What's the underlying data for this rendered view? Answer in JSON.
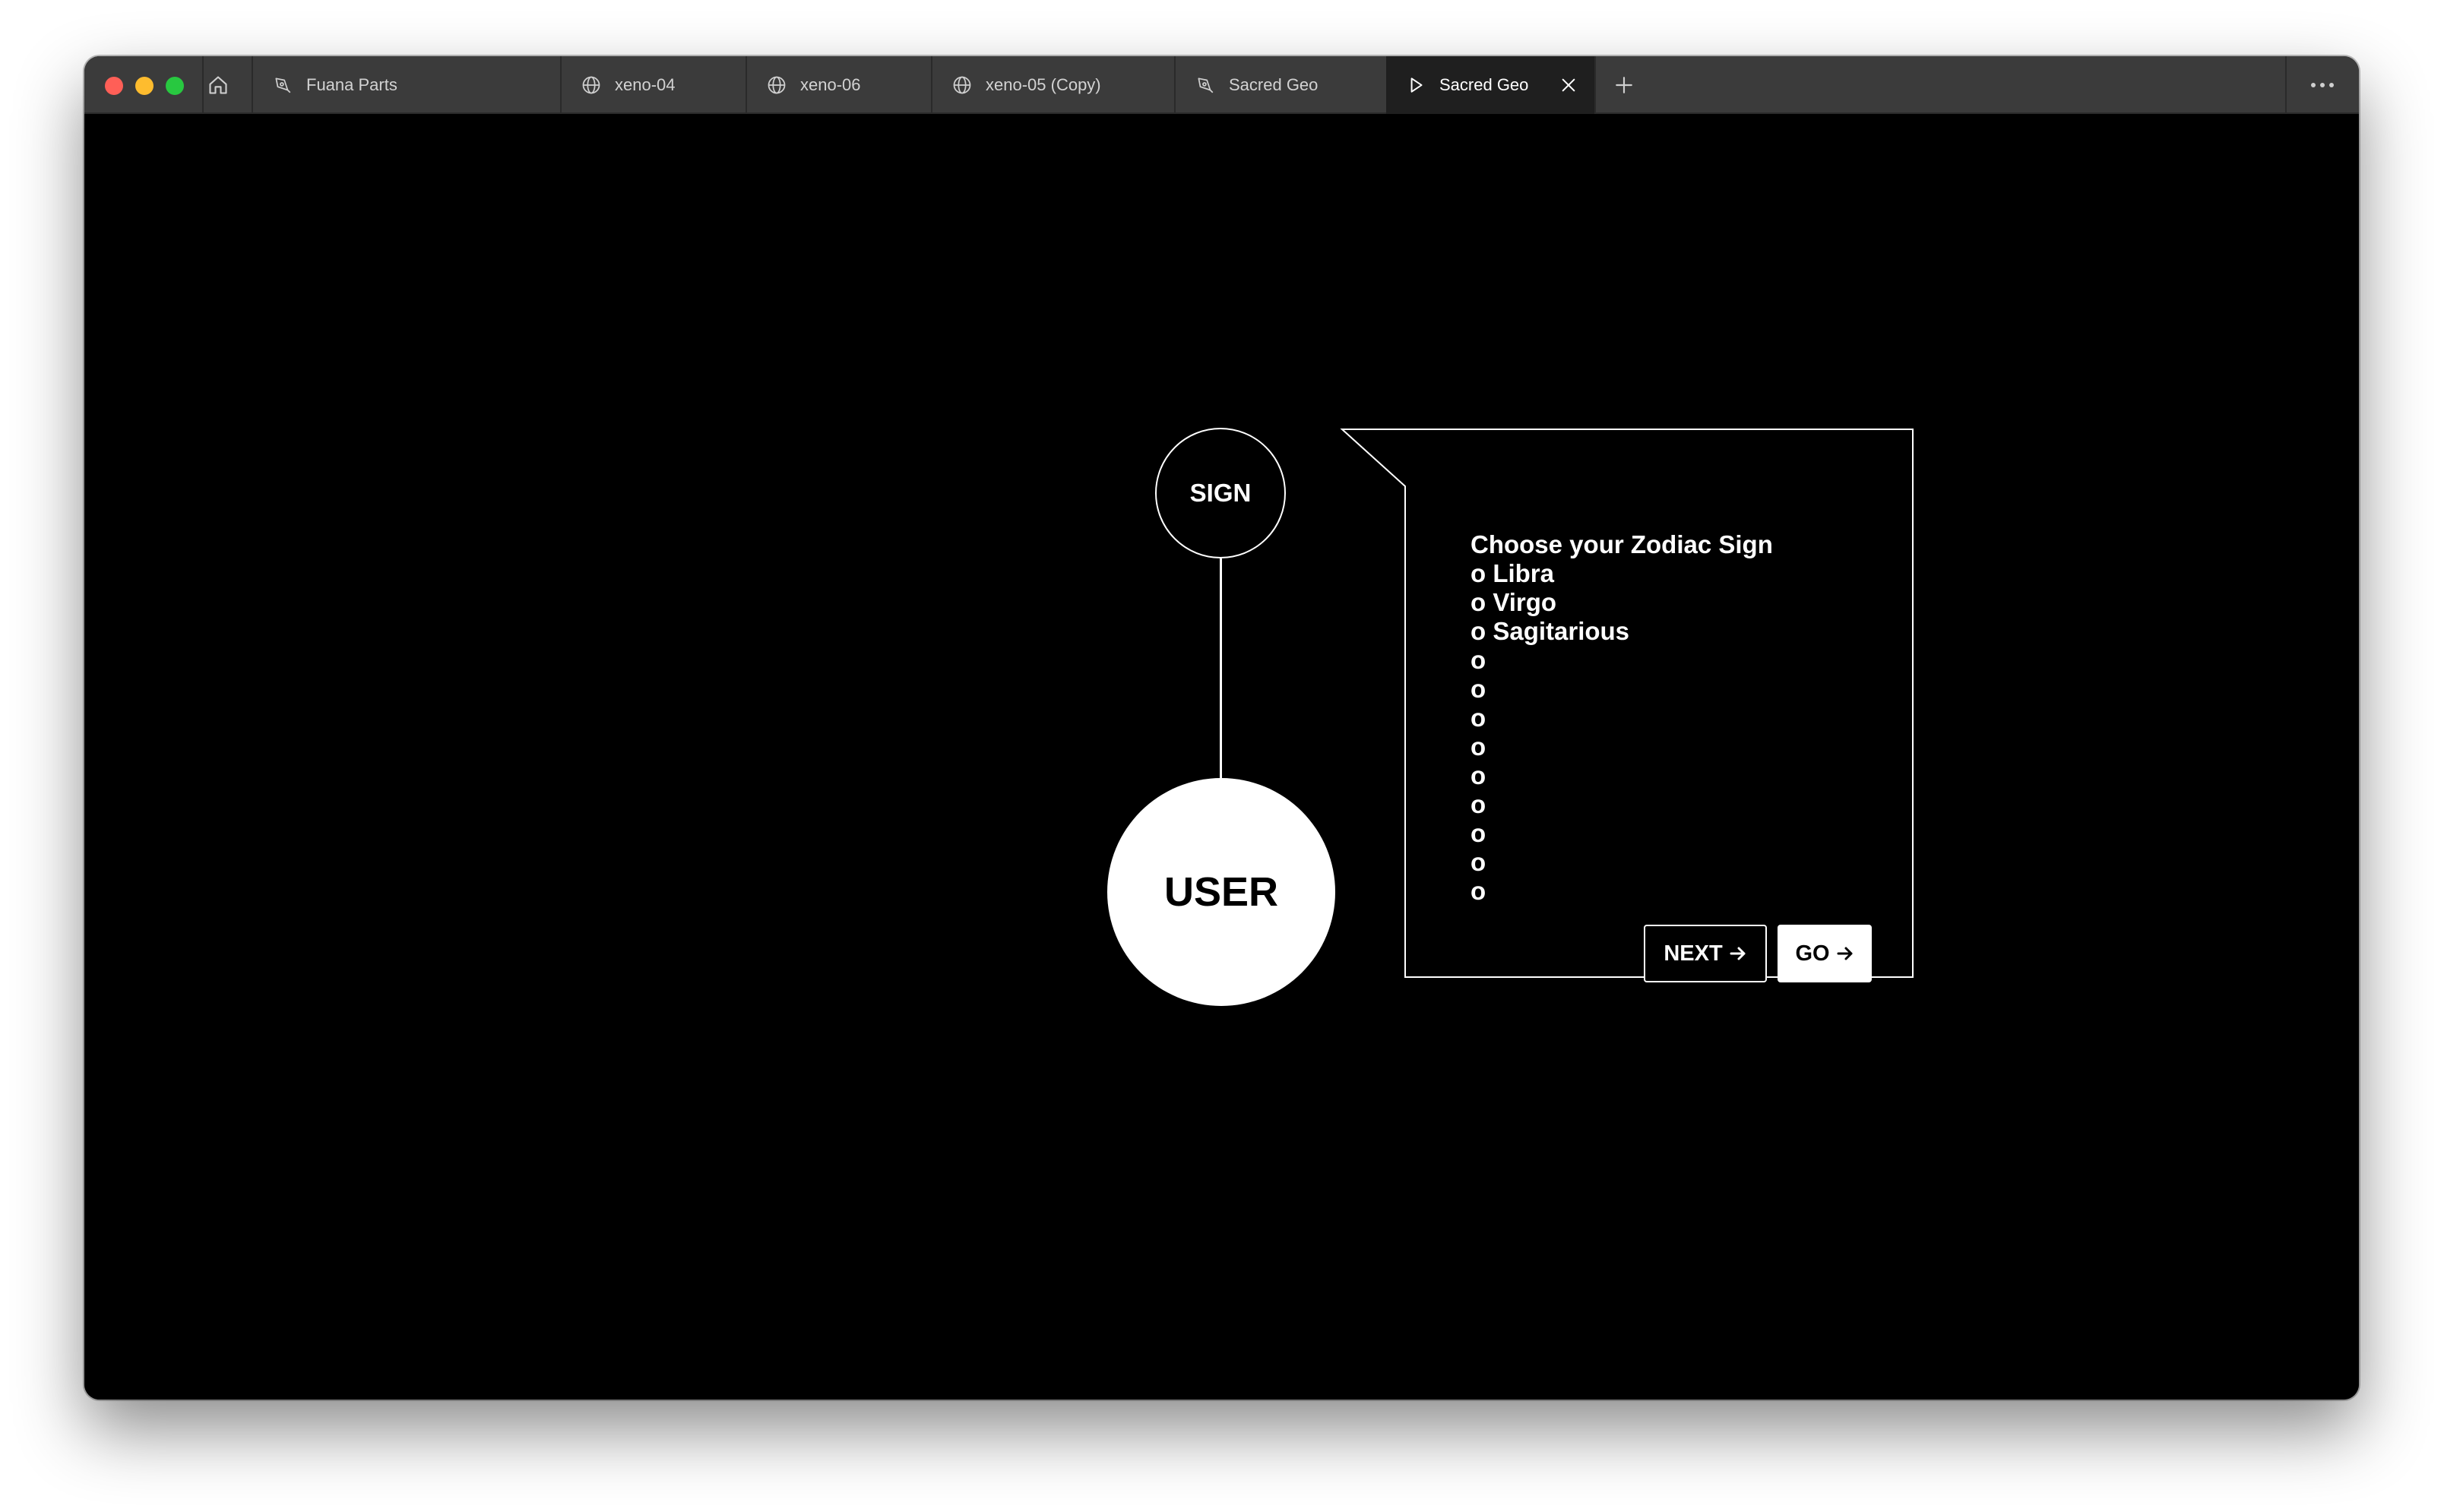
{
  "titlebar": {
    "tabs": [
      {
        "label": "Fuana Parts",
        "icon": "pen-nib-icon"
      },
      {
        "label": "xeno-04",
        "icon": "globe-icon"
      },
      {
        "label": "xeno-06",
        "icon": "globe-icon"
      },
      {
        "label": "xeno-05 (Copy)",
        "icon": "globe-icon"
      },
      {
        "label": "Sacred Geo",
        "icon": "pen-nib-icon"
      },
      {
        "label": "Sacred Geo",
        "icon": "play-icon",
        "active": true
      }
    ]
  },
  "canvas": {
    "sign_label": "SIGN",
    "user_label": "USER",
    "heading": "Choose your Zodiac Sign",
    "options": [
      "o Libra",
      "o Virgo",
      "o Sagitarious",
      "o",
      "o",
      "o",
      "o",
      "o",
      "o",
      "o",
      "o",
      "o"
    ],
    "next_label": "NEXT",
    "go_label": "GO"
  },
  "colors": {
    "background": "#000000",
    "titlebar": "#3b3b3b",
    "active_tab": "#1f1f1f",
    "foreground": "#ffffff",
    "close_dot": "#ff5f57",
    "minimize_dot": "#febc2e",
    "zoom_dot": "#28c840"
  }
}
